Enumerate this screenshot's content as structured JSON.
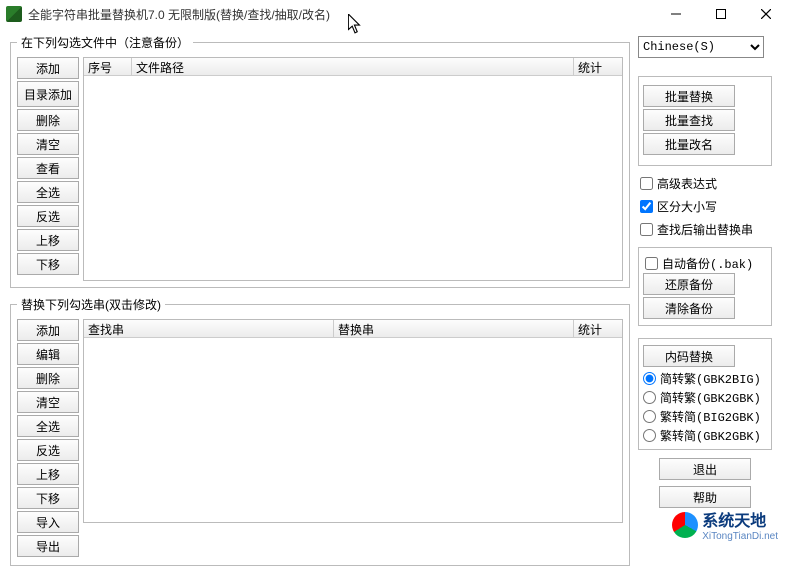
{
  "window": {
    "title": "全能字符串批量替换机7.0 无限制版(替换/查找/抽取/改名)"
  },
  "language": {
    "selected": "Chinese(S)"
  },
  "group1": {
    "legend": " 在下列勾选文件中（注意备份）",
    "buttons": [
      "添加",
      "目录添加",
      "删除",
      "清空",
      "查看",
      "全选",
      "反选",
      "上移",
      "下移"
    ],
    "columns": {
      "no": "序号",
      "path": "文件路径",
      "stats": "统计"
    }
  },
  "group2": {
    "legend": " 替换下列勾选串(双击修改)",
    "buttons": [
      "添加",
      "编辑",
      "删除",
      "清空",
      "全选",
      "反选",
      "上移",
      "下移",
      "导入",
      "导出"
    ],
    "columns": {
      "find": "查找串",
      "replace": "替换串",
      "stats": "统计"
    }
  },
  "right": {
    "batchReplace": "批量替换",
    "batchFind": "批量查找",
    "batchRename": "批量改名",
    "advanced": "高级表达式",
    "caseSensitive": "区分大小写",
    "outputReplaced": "查找后输出替换串",
    "autobackup": "自动备份(.bak)",
    "restoreBackup": "还原备份",
    "clearBackup": "清除备份",
    "encodingReplace": "内码替换",
    "radios": [
      "简转繁(GBK2BIG)",
      "简转繁(GBK2GBK)",
      "繁转简(BIG2GBK)",
      "繁转简(GBK2GBK)"
    ],
    "exit": "退出",
    "help": "帮助"
  },
  "watermark": {
    "brand": "系统天地",
    "url": "XiTongTianDi.net"
  }
}
